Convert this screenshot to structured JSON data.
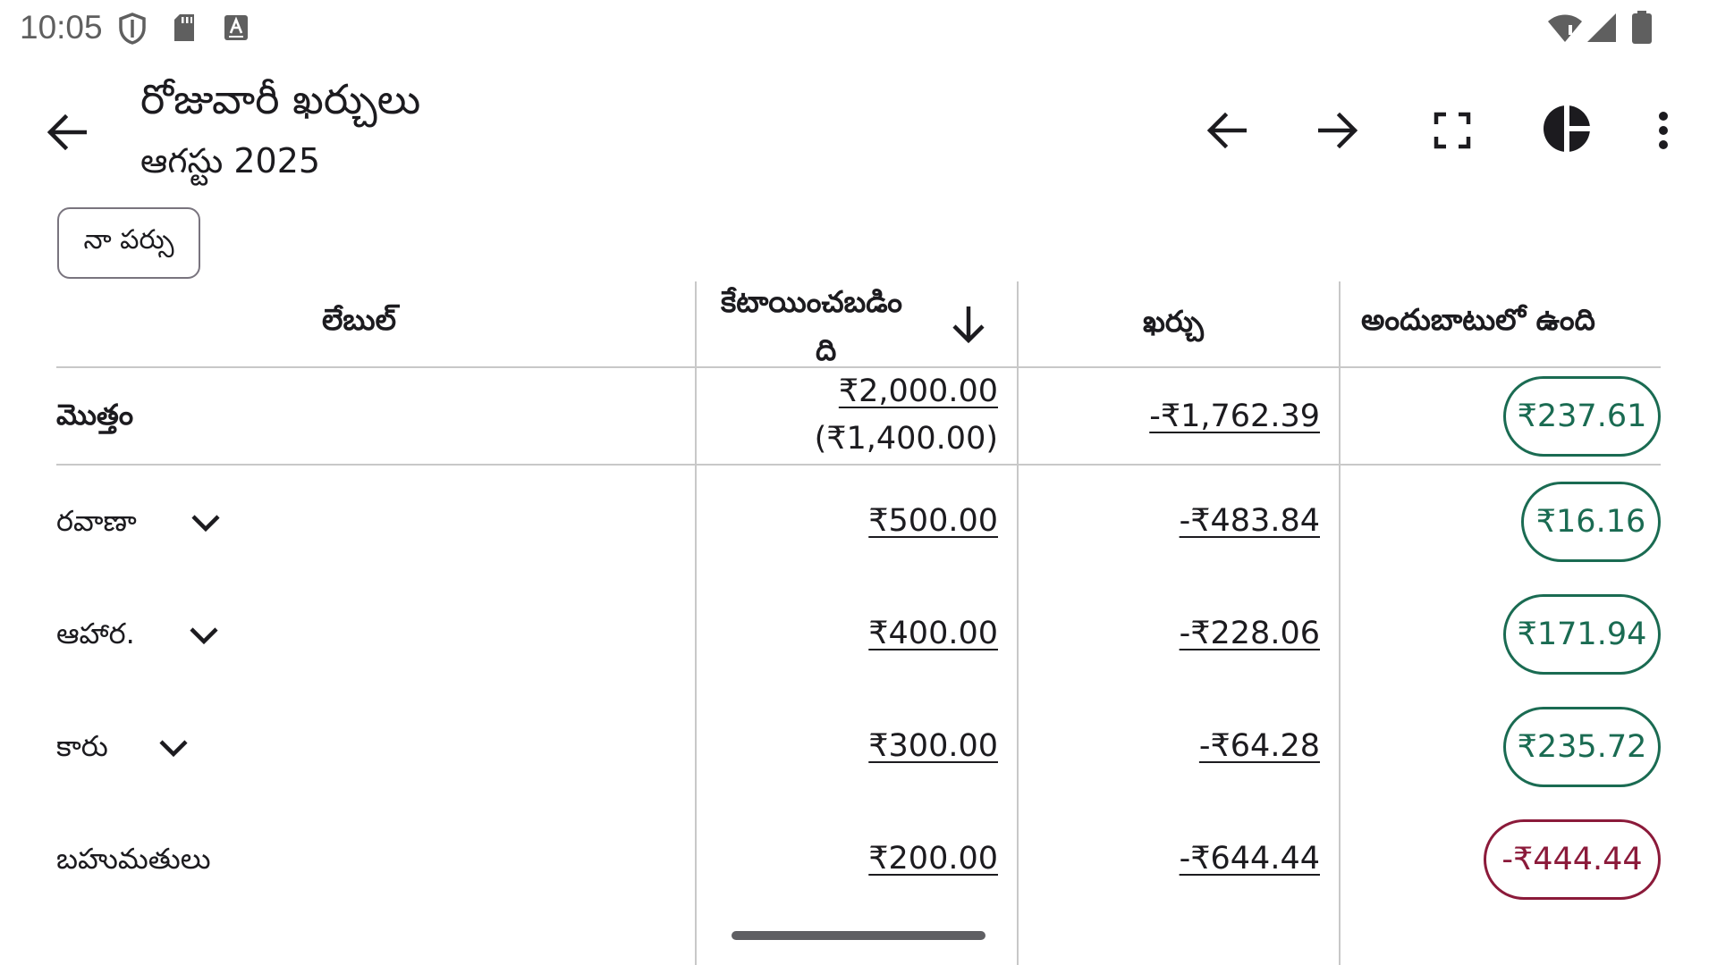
{
  "status_bar": {
    "time": "10:05",
    "left_icons": [
      "shield-icon",
      "sd-card-icon",
      "keyboard-icon"
    ],
    "right_icons": [
      "wifi-icon",
      "cell-signal-icon",
      "battery-icon"
    ]
  },
  "app_bar": {
    "title": "రోజువారీ ఖర్చులు",
    "subtitle": "ఆగస్టు 2025",
    "actions": [
      "back-arrow-icon",
      "previous-arrow-icon",
      "next-arrow-icon",
      "fullscreen-icon",
      "pie-chart-icon",
      "more-vert-icon"
    ]
  },
  "filter_chip": {
    "label": "నా పర్సు"
  },
  "table": {
    "headers": {
      "label": "లేబుల్",
      "allocated_line1": "కేటాయించబడిం",
      "allocated_line2": "ది",
      "spent": "ఖర్చు",
      "available": "అందుబాటులో ఉంది"
    },
    "sort_indicator": "arrow-down-icon",
    "total": {
      "label": "మొత్తం",
      "allocated": "₹2,000.00",
      "allocated_note": "(₹1,400.00)",
      "spent": "-₹1,762.39",
      "available": "₹237.61"
    },
    "rows": [
      {
        "label": "రవాణా",
        "allocated": "₹500.00",
        "spent": "-₹483.84",
        "available": "₹16.16",
        "status": "positive",
        "expandable": true
      },
      {
        "label": "ఆహార.",
        "allocated": "₹400.00",
        "spent": "-₹228.06",
        "available": "₹171.94",
        "status": "positive",
        "expandable": true
      },
      {
        "label": "కారు",
        "allocated": "₹300.00",
        "spent": "-₹64.28",
        "available": "₹235.72",
        "status": "positive",
        "expandable": true
      },
      {
        "label": "బహుమతులు",
        "allocated": "₹200.00",
        "spent": "-₹644.44",
        "available": "-₹444.44",
        "status": "negative",
        "expandable": false
      }
    ]
  },
  "colors": {
    "positive": "#1a6b52",
    "negative": "#8b1a3a",
    "divider": "#c8c8c8",
    "text": "#1c1b1f"
  }
}
